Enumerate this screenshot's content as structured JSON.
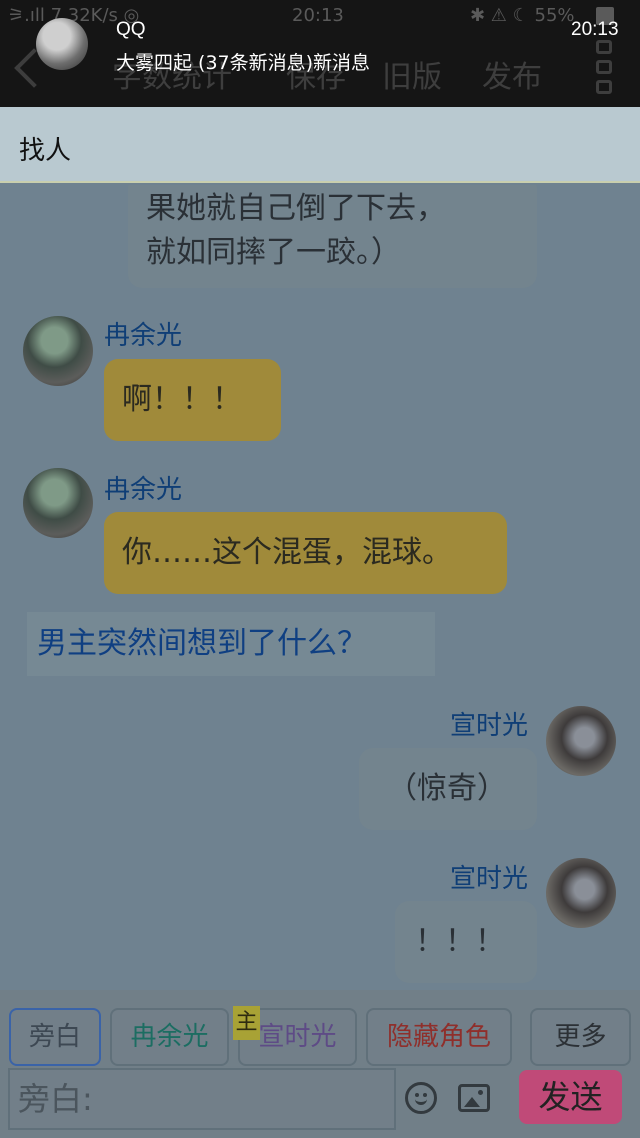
{
  "status_bar": {
    "left": "⚞.ıll 7.32K/s ◎",
    "center": "20:13",
    "right": "✱ ⚠ ☾ 55%"
  },
  "notification": {
    "app": "QQ",
    "text": "大雾四起 (37条新消息)新消息",
    "time": "20:13"
  },
  "toolbar": {
    "items": [
      "字数统计",
      "保存",
      "旧版",
      "发布"
    ]
  },
  "find_row": {
    "label": "找人"
  },
  "messages": [
    {
      "type": "narration_cont",
      "lines": [
        "果她就自己倒了下去，",
        "就如同摔了一跤。）"
      ]
    },
    {
      "type": "left",
      "name": "冉余光",
      "text": "啊！！！"
    },
    {
      "type": "left",
      "name": "冉余光",
      "text": "你……这个混蛋，混球。"
    },
    {
      "type": "narration",
      "text": "男主突然间想到了什么？"
    },
    {
      "type": "right",
      "name": "宣时光",
      "text": "（惊奇）"
    },
    {
      "type": "right",
      "name": "宣时光",
      "text": "！！！"
    }
  ],
  "roles": [
    {
      "label": "旁白",
      "color": "#3d4853"
    },
    {
      "label": "冉余光",
      "color": "#1c6d62"
    },
    {
      "label": "宣时光",
      "color": "#5e4b86"
    },
    {
      "label": "隐藏角色",
      "color": "#8f2f2b"
    },
    {
      "label": "更多",
      "color": "#2c3136"
    }
  ],
  "role_badge": "主",
  "input": {
    "value": "旁白:"
  },
  "send_label": "发送"
}
